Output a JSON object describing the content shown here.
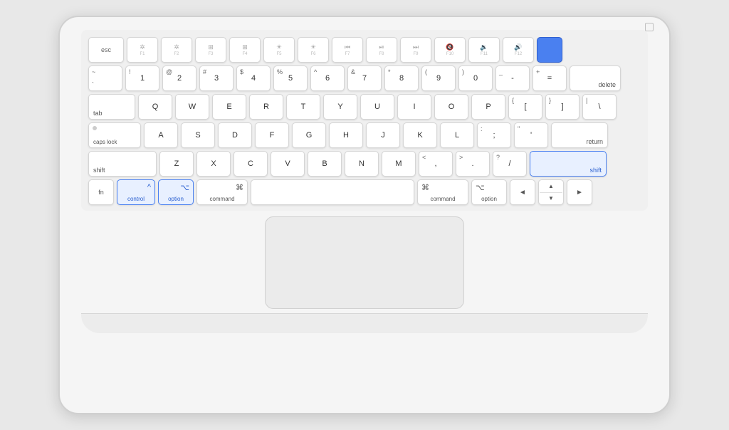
{
  "keyboard": {
    "rows": {
      "function_row": {
        "keys": [
          {
            "id": "esc",
            "label": "esc",
            "width": "w-esc"
          },
          {
            "id": "f1",
            "label": "✶",
            "sub": "F1",
            "width": "w-fkey"
          },
          {
            "id": "f2",
            "label": "✶",
            "sub": "F2",
            "width": "w-fkey"
          },
          {
            "id": "f3",
            "label": "⊞",
            "sub": "F3",
            "width": "w-fkey"
          },
          {
            "id": "f4",
            "label": "⊞",
            "sub": "F4",
            "width": "w-fkey"
          },
          {
            "id": "f5",
            "label": "⊙",
            "sub": "F5",
            "width": "w-fkey"
          },
          {
            "id": "f6",
            "label": "⊙",
            "sub": "F6",
            "width": "w-fkey"
          },
          {
            "id": "f7",
            "label": "◄◄",
            "sub": "F7",
            "width": "w-fkey"
          },
          {
            "id": "f8",
            "label": "►||",
            "sub": "F8",
            "width": "w-fkey"
          },
          {
            "id": "f9",
            "label": "►►",
            "sub": "F9",
            "width": "w-fkey"
          },
          {
            "id": "f10",
            "label": "🔇",
            "sub": "F10",
            "width": "w-fkey"
          },
          {
            "id": "f11",
            "label": "🔉",
            "sub": "F11",
            "width": "w-fkey"
          },
          {
            "id": "f12",
            "label": "🔊",
            "sub": "F12",
            "width": "w-fkey"
          },
          {
            "id": "power",
            "label": "",
            "width": "w-power",
            "highlight": "power"
          }
        ]
      },
      "number_row": {
        "keys": [
          {
            "id": "backtick",
            "top": "~",
            "bottom": "`",
            "width": "w-std"
          },
          {
            "id": "1",
            "top": "!",
            "bottom": "1",
            "width": "w-std"
          },
          {
            "id": "2",
            "top": "@",
            "bottom": "2",
            "width": "w-std"
          },
          {
            "id": "3",
            "top": "#",
            "bottom": "3",
            "width": "w-std"
          },
          {
            "id": "4",
            "top": "$",
            "bottom": "4",
            "width": "w-std"
          },
          {
            "id": "5",
            "top": "%",
            "bottom": "5",
            "width": "w-std"
          },
          {
            "id": "6",
            "top": "^",
            "bottom": "6",
            "width": "w-std"
          },
          {
            "id": "7",
            "top": "&",
            "bottom": "7",
            "width": "w-std"
          },
          {
            "id": "8",
            "top": "*",
            "bottom": "8",
            "width": "w-std"
          },
          {
            "id": "9",
            "top": "(",
            "bottom": "9",
            "width": "w-std"
          },
          {
            "id": "0",
            "top": ")",
            "bottom": "0",
            "width": "w-std"
          },
          {
            "id": "minus",
            "top": "_",
            "bottom": "-",
            "width": "w-std"
          },
          {
            "id": "equals",
            "top": "+",
            "bottom": "=",
            "width": "w-std"
          },
          {
            "id": "delete",
            "label": "delete",
            "width": "w-delete"
          }
        ]
      },
      "qwerty_row": {
        "keys": [
          {
            "id": "tab",
            "label": "tab",
            "width": "w-tab"
          },
          {
            "id": "q",
            "label": "Q",
            "width": "w-std"
          },
          {
            "id": "w",
            "label": "W",
            "width": "w-std"
          },
          {
            "id": "e",
            "label": "E",
            "width": "w-std"
          },
          {
            "id": "r",
            "label": "R",
            "width": "w-std"
          },
          {
            "id": "t",
            "label": "T",
            "width": "w-std"
          },
          {
            "id": "y",
            "label": "Y",
            "width": "w-std"
          },
          {
            "id": "u",
            "label": "U",
            "width": "w-std"
          },
          {
            "id": "i",
            "label": "I",
            "width": "w-std"
          },
          {
            "id": "o",
            "label": "O",
            "width": "w-std"
          },
          {
            "id": "p",
            "label": "P",
            "width": "w-std"
          },
          {
            "id": "lbracket",
            "top": "{",
            "bottom": "[",
            "width": "w-std"
          },
          {
            "id": "rbracket",
            "top": "}",
            "bottom": "]",
            "width": "w-std"
          },
          {
            "id": "backslash",
            "top": "|",
            "bottom": "\\",
            "width": "w-std"
          }
        ]
      },
      "home_row": {
        "keys": [
          {
            "id": "capslock",
            "label": "caps lock",
            "width": "w-capslock",
            "dot": true
          },
          {
            "id": "a",
            "label": "A",
            "width": "w-std"
          },
          {
            "id": "s",
            "label": "S",
            "width": "w-std"
          },
          {
            "id": "d",
            "label": "D",
            "width": "w-std"
          },
          {
            "id": "f",
            "label": "F",
            "width": "w-std"
          },
          {
            "id": "g",
            "label": "G",
            "width": "w-std"
          },
          {
            "id": "h",
            "label": "H",
            "width": "w-std"
          },
          {
            "id": "j",
            "label": "J",
            "width": "w-std"
          },
          {
            "id": "k",
            "label": "K",
            "width": "w-std"
          },
          {
            "id": "l",
            "label": "L",
            "width": "w-std"
          },
          {
            "id": "semicolon",
            "top": ":",
            "bottom": ";",
            "width": "w-std"
          },
          {
            "id": "quote",
            "top": "\"",
            "bottom": "'",
            "width": "w-std"
          },
          {
            "id": "return",
            "label": "return",
            "width": "w-return"
          }
        ]
      },
      "shift_row": {
        "keys": [
          {
            "id": "shift-l",
            "label": "shift",
            "width": "w-shift-l"
          },
          {
            "id": "z",
            "label": "Z",
            "width": "w-std"
          },
          {
            "id": "x",
            "label": "X",
            "width": "w-std"
          },
          {
            "id": "c",
            "label": "C",
            "width": "w-std"
          },
          {
            "id": "v",
            "label": "V",
            "width": "w-std"
          },
          {
            "id": "b",
            "label": "B",
            "width": "w-std"
          },
          {
            "id": "n",
            "label": "N",
            "width": "w-std"
          },
          {
            "id": "m",
            "label": "M",
            "width": "w-std"
          },
          {
            "id": "comma",
            "top": "<",
            "bottom": ",",
            "width": "w-std"
          },
          {
            "id": "period",
            "top": ">",
            "bottom": ".",
            "width": "w-std"
          },
          {
            "id": "slash",
            "top": "?",
            "bottom": "/",
            "width": "w-std"
          },
          {
            "id": "shift-r",
            "label": "shift",
            "width": "w-shift-r",
            "highlight": "shift"
          }
        ]
      },
      "modifier_row": {
        "keys": [
          {
            "id": "fn",
            "label": "fn",
            "width": "w-fn-key"
          },
          {
            "id": "control",
            "label": "control",
            "icon": "^",
            "width": "w-control",
            "highlight": "blue"
          },
          {
            "id": "option-l",
            "label": "option",
            "icon": "⌥",
            "width": "w-option-l",
            "highlight": "blue"
          },
          {
            "id": "command-l",
            "label": "command",
            "icon": "⌘",
            "width": "w-command-l"
          },
          {
            "id": "space",
            "label": "",
            "width": "w-space"
          },
          {
            "id": "command-r",
            "label": "command",
            "icon": "⌘",
            "width": "w-command-r"
          },
          {
            "id": "option-r",
            "label": "option",
            "icon": "⌥",
            "width": "w-option-r"
          },
          {
            "id": "arrow-l",
            "label": "◄",
            "width": "w-arrow"
          },
          {
            "id": "arrow-ud",
            "label": "▲▼",
            "width": "w-arrow",
            "split": true
          },
          {
            "id": "arrow-r",
            "label": "►",
            "width": "w-arrow"
          }
        ]
      }
    }
  }
}
